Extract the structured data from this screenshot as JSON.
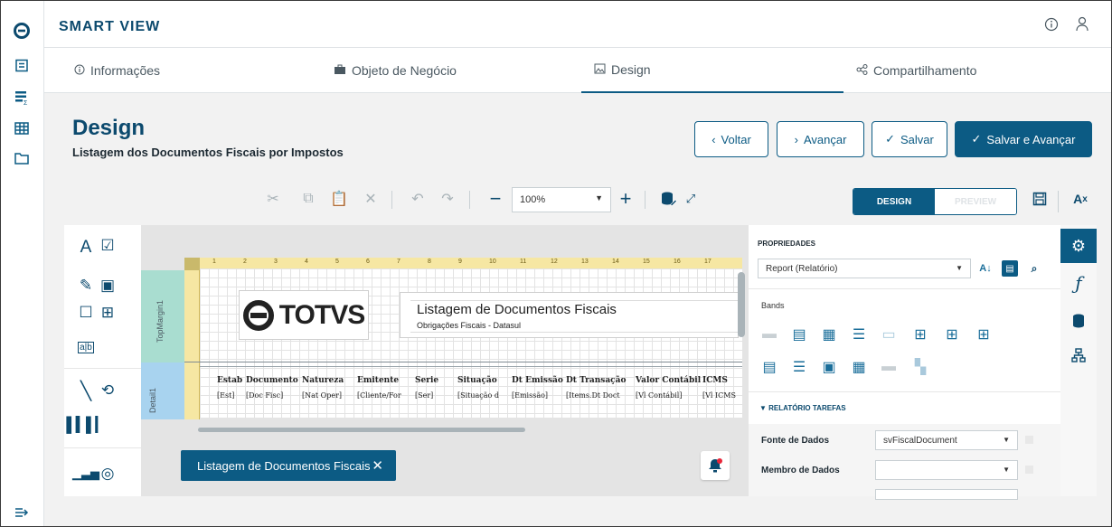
{
  "app": {
    "title": "SMART VIEW"
  },
  "tabs": [
    {
      "label": "Informações",
      "icon": "info-icon"
    },
    {
      "label": "Objeto de Negócio",
      "icon": "briefcase-icon"
    },
    {
      "label": "Design",
      "icon": "image-icon"
    },
    {
      "label": "Compartilhamento",
      "icon": "share-icon"
    }
  ],
  "page": {
    "title": "Design",
    "subtitle": "Listagem dos Documentos Fiscais por Impostos"
  },
  "actions": {
    "back": "Voltar",
    "next": "Avançar",
    "save": "Salvar",
    "save_next": "Salvar e Avançar"
  },
  "toolbar": {
    "zoom": "100%",
    "mode_design": "DESIGN",
    "mode_preview": "PREVIEW"
  },
  "report": {
    "title": "Listagem de Documentos Fiscais",
    "subtitle": "Obrigações Fiscais - Datasul",
    "logo_text": "TOTVS",
    "band_top": "TopMargin1",
    "band_detail": "Detail1",
    "ruler_ticks": [
      "1",
      "2",
      "3",
      "4",
      "5",
      "6",
      "7",
      "8",
      "9",
      "10",
      "11",
      "12",
      "13",
      "14",
      "15",
      "16",
      "17"
    ],
    "headers": [
      "Estab",
      "Documento",
      "Natureza",
      "Emitente",
      "Serie",
      "Situação",
      "Dt Emissão",
      "Dt Transação",
      "Valor Contábil",
      "ICMS"
    ],
    "cells": [
      "[Est]",
      "[Doc Fisc]",
      "[Nat Oper]",
      "[Cliente/For",
      "[Ser]",
      "[Situação d",
      "[Emissão]",
      "[Items.Dt Doct",
      "[Vl Contábil]",
      "[Vl ICMS"
    ]
  },
  "chip": {
    "label": "Listagem de Documentos Fiscais"
  },
  "properties": {
    "title": "PROPRIEDADES",
    "object": "Report (Relatório)",
    "bands_label": "Bands",
    "section": "RELATÓRIO TAREFAS",
    "data_source_label": "Fonte de Dados",
    "data_source_value": "svFiscalDocument",
    "data_member_label": "Membro de Dados",
    "data_member_value": ""
  }
}
